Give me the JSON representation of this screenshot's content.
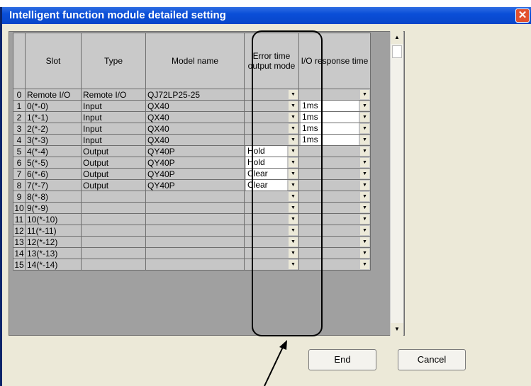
{
  "window": {
    "title": "Intelligent function module detailed setting"
  },
  "grid": {
    "headers": [
      "",
      "Slot",
      "Type",
      "Model name",
      "Error time output mode",
      "I/O response time"
    ],
    "rows": [
      {
        "no": "0",
        "slot": "Remote I/O",
        "type": "Remote I/O",
        "model": "QJ72LP25-25",
        "err": "",
        "io": ""
      },
      {
        "no": "1",
        "slot": "0(*-0)",
        "type": "Input",
        "model": "QX40",
        "err": "",
        "io": "1ms"
      },
      {
        "no": "2",
        "slot": "1(*-1)",
        "type": "Input",
        "model": "QX40",
        "err": "",
        "io": "1ms"
      },
      {
        "no": "3",
        "slot": "2(*-2)",
        "type": "Input",
        "model": "QX40",
        "err": "",
        "io": "1ms"
      },
      {
        "no": "4",
        "slot": "3(*-3)",
        "type": "Input",
        "model": "QX40",
        "err": "",
        "io": "1ms"
      },
      {
        "no": "5",
        "slot": "4(*-4)",
        "type": "Output",
        "model": "QY40P",
        "err": "Hold",
        "io": ""
      },
      {
        "no": "6",
        "slot": "5(*-5)",
        "type": "Output",
        "model": "QY40P",
        "err": "Hold",
        "io": ""
      },
      {
        "no": "7",
        "slot": "6(*-6)",
        "type": "Output",
        "model": "QY40P",
        "err": "Clear",
        "io": ""
      },
      {
        "no": "8",
        "slot": "7(*-7)",
        "type": "Output",
        "model": "QY40P",
        "err": "Clear",
        "io": ""
      },
      {
        "no": "9",
        "slot": "8(*-8)",
        "type": "",
        "model": "",
        "err": "",
        "io": ""
      },
      {
        "no": "10",
        "slot": "9(*-9)",
        "type": "",
        "model": "",
        "err": "",
        "io": ""
      },
      {
        "no": "11",
        "slot": "10(*-10)",
        "type": "",
        "model": "",
        "err": "",
        "io": ""
      },
      {
        "no": "12",
        "slot": "11(*-11)",
        "type": "",
        "model": "",
        "err": "",
        "io": ""
      },
      {
        "no": "13",
        "slot": "12(*-12)",
        "type": "",
        "model": "",
        "err": "",
        "io": ""
      },
      {
        "no": "14",
        "slot": "13(*-13)",
        "type": "",
        "model": "",
        "err": "",
        "io": ""
      },
      {
        "no": "15",
        "slot": "14(*-14)",
        "type": "",
        "model": "",
        "err": "",
        "io": ""
      }
    ]
  },
  "buttons": {
    "end": "End",
    "cancel": "Cancel"
  },
  "icons": {
    "close": "close-icon",
    "dropdown": "chevron-down-icon",
    "scroll_up": "arrow-up-icon",
    "scroll_down": "arrow-down-icon"
  }
}
